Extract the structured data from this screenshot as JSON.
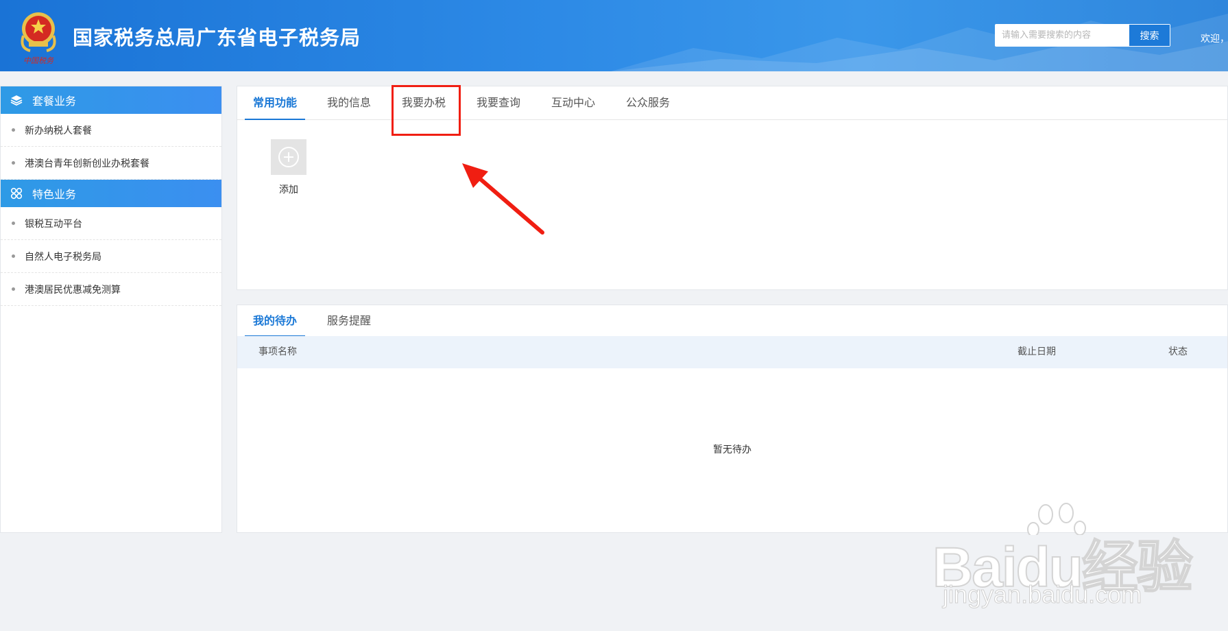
{
  "header": {
    "title": "国家税务总局广东省电子税务局",
    "emblem_caption": "中国税务",
    "search": {
      "placeholder": "请输入需要搜索的内容",
      "value": "",
      "button_label": "搜索"
    },
    "welcome": "欢迎，"
  },
  "sidebar": {
    "sections": [
      {
        "title": "套餐业务",
        "icon": "layers-icon",
        "items": [
          "新办纳税人套餐",
          "港澳台青年创新创业办税套餐"
        ]
      },
      {
        "title": "特色业务",
        "icon": "grid-icon",
        "items": [
          "银税互动平台",
          "自然人电子税务局",
          "港澳居民优惠减免测算"
        ]
      }
    ]
  },
  "functions_panel": {
    "tabs": [
      "常用功能",
      "我的信息",
      "我要办税",
      "我要查询",
      "互动中心",
      "公众服务"
    ],
    "active_tab": "常用功能",
    "highlighted_tab": "我要办税",
    "add_label": "添加"
  },
  "todo_panel": {
    "tabs": [
      "我的待办",
      "服务提醒"
    ],
    "active_tab": "我的待办",
    "columns": [
      "事项名称",
      "截止日期",
      "状态"
    ],
    "empty_text": "暂无待办"
  },
  "watermark": {
    "brand": "Baidu经验",
    "url": "jingyan.baidu.com"
  },
  "colors": {
    "accent": "#1a78d6",
    "header_bg": "#2d8ae6",
    "annotation": "#f01e12"
  }
}
